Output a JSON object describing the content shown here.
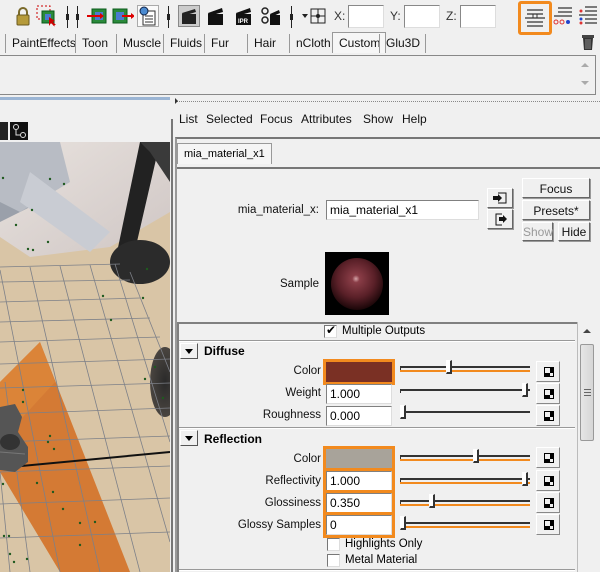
{
  "toolbar": {
    "icons": [
      {
        "name": "lock-icon"
      },
      {
        "name": "select-region-icon"
      },
      {
        "name": "input-connection-icon"
      },
      {
        "name": "output-connection-icon"
      },
      {
        "name": "history-icon"
      },
      {
        "name": "render-view-icon"
      },
      {
        "name": "render-current-frame-icon"
      },
      {
        "name": "ipr-render-icon"
      },
      {
        "name": "render-settings-icon"
      },
      {
        "name": "snap-mode-icon"
      },
      {
        "name": "channel-box-icon"
      },
      {
        "name": "tool-settings-icon"
      },
      {
        "name": "attribute-editor-toggle-icon"
      }
    ],
    "coords": {
      "x_label": "X:",
      "y_label": "Y:",
      "z_label": "Z:",
      "x_value": "",
      "y_value": "",
      "z_value": ""
    }
  },
  "shelf": {
    "tabs": [
      "PaintEffects",
      "Toon",
      "Muscle",
      "Fluids",
      "Fur",
      "Hair",
      "nCloth",
      "Custom",
      "Glu3D"
    ],
    "active_tab": "Custom"
  },
  "attribute_editor": {
    "menu": [
      "List",
      "Selected",
      "Focus",
      "Attributes",
      "Show",
      "Help"
    ],
    "node_tab": "mia_material_x1",
    "node_type_label": "mia_material_x:",
    "node_name": "mia_material_x1",
    "buttons": {
      "focus": "Focus",
      "presets": "Presets*",
      "show": "Show",
      "hide": "Hide"
    },
    "sample_label": "Sample",
    "multiple_outputs": {
      "label": "Multiple Outputs",
      "checked": true
    },
    "sections": {
      "diffuse": {
        "title": "Diffuse",
        "color": {
          "label": "Color",
          "swatch": "#7a3024",
          "slider": 0.38
        },
        "weight": {
          "label": "Weight",
          "value": "1.000",
          "slider": 1.0
        },
        "roughness": {
          "label": "Roughness",
          "value": "0.000",
          "slider": 0.0
        }
      },
      "reflection": {
        "title": "Reflection",
        "color": {
          "label": "Color",
          "swatch": "#a8a39a",
          "slider": 0.6
        },
        "reflectivity": {
          "label": "Reflectivity",
          "value": "1.000",
          "slider": 1.0
        },
        "glossiness": {
          "label": "Glossiness",
          "value": "0.350",
          "slider": 0.24
        },
        "glossy_samples": {
          "label": "Glossy Samples",
          "value": "0",
          "slider": 0.0
        },
        "highlights_only": {
          "label": "Highlights Only",
          "checked": false
        },
        "metal_material": {
          "label": "Metal Material",
          "checked": false
        }
      }
    }
  },
  "colors": {
    "highlight": "#f28a1e"
  }
}
